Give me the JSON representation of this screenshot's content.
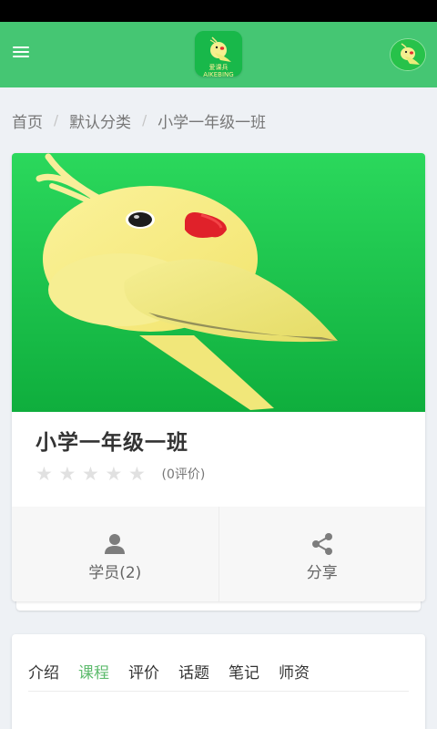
{
  "header": {
    "logo_text": "爱课兵 AIKEBING",
    "menu_icon": "hamburger-menu-icon",
    "avatar_icon": "bird-avatar-icon",
    "brand_color": "#45c673"
  },
  "breadcrumb": {
    "items": [
      "首页",
      "默认分类",
      "小学一年级一班"
    ],
    "separator": "/"
  },
  "course": {
    "title": "小学一年级一班",
    "rating_stars": 0,
    "rating_max": 5,
    "review_count": "(0评价)",
    "cover_icon": "bird-mascot-illustration"
  },
  "stats": {
    "students_label": "学员(2)",
    "students_icon": "user-icon",
    "share_label": "分享",
    "share_icon": "share-icon"
  },
  "tabs": {
    "items": [
      "介绍",
      "课程",
      "评价",
      "话题",
      "笔记",
      "师资"
    ],
    "active_index": 1,
    "active_color": "#5dbb6d"
  }
}
